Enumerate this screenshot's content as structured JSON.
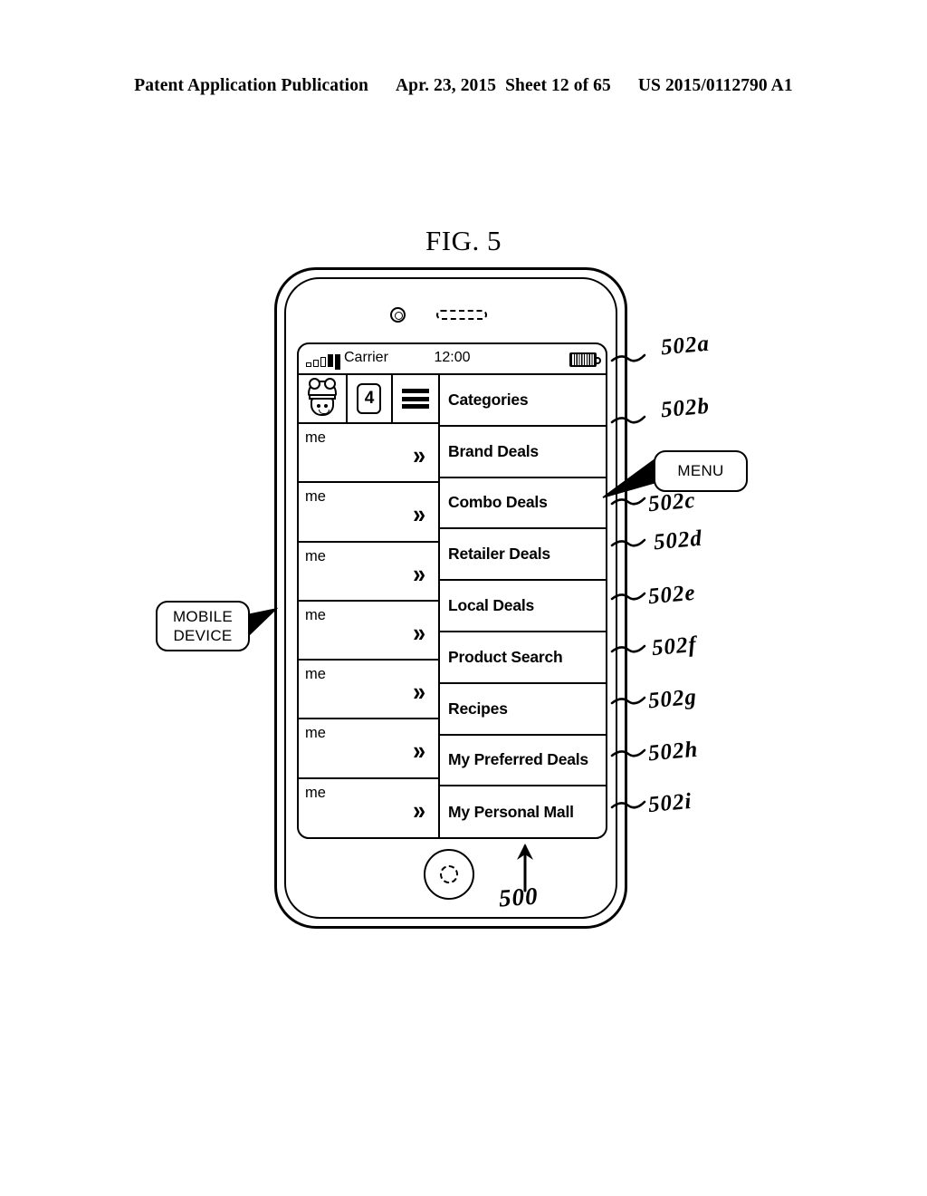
{
  "page_header": {
    "left": "Patent Application Publication",
    "date": "Apr. 23, 2015",
    "sheet": "Sheet 12 of 65",
    "pub_number": "US 2015/0112790 A1"
  },
  "figure": {
    "title": "FIG. 5",
    "device_ref": "500"
  },
  "callouts": {
    "mobile_device_line1": "MOBILE",
    "mobile_device_line2": "DEVICE",
    "menu": "MENU"
  },
  "phone": {
    "icons": {
      "camera": "camera-icon",
      "speaker": "speaker-grille-icon",
      "home": "home-button-icon"
    },
    "status_bar": {
      "signal": "signal-bars-icon",
      "carrier": "Carrier",
      "time": "12:00",
      "battery": "battery-icon"
    },
    "toolbar": {
      "chef_icon": "chef-icon",
      "count_badge": "4",
      "menu_icon": "hamburger-menu-icon"
    },
    "left_column": {
      "rows": [
        {
          "label": "me",
          "chevron": "»"
        },
        {
          "label": "me",
          "chevron": "»"
        },
        {
          "label": "me",
          "chevron": "»"
        },
        {
          "label": "me",
          "chevron": "»"
        },
        {
          "label": "me",
          "chevron": "»"
        },
        {
          "label": "me",
          "chevron": "»"
        },
        {
          "label": "me",
          "chevron": "»"
        }
      ]
    },
    "menu_items": [
      {
        "label": "Categories",
        "ref": "502a"
      },
      {
        "label": "Brand Deals",
        "ref": "502b"
      },
      {
        "label": "Combo Deals",
        "ref": "502c"
      },
      {
        "label": "Retailer Deals",
        "ref": "502d"
      },
      {
        "label": "Local Deals",
        "ref": "502e"
      },
      {
        "label": "Product Search",
        "ref": "502f"
      },
      {
        "label": "Recipes",
        "ref": "502g"
      },
      {
        "label": "My Preferred Deals",
        "ref": "502h"
      },
      {
        "label": "My Personal Mall",
        "ref": "502i"
      }
    ]
  },
  "reference_numerals": {
    "r0": "502a",
    "r1": "502b",
    "r2": "502c",
    "r3": "502d",
    "r4": "502e",
    "r5": "502f",
    "r6": "502g",
    "r7": "502h",
    "r8": "502i",
    "device": "500"
  }
}
